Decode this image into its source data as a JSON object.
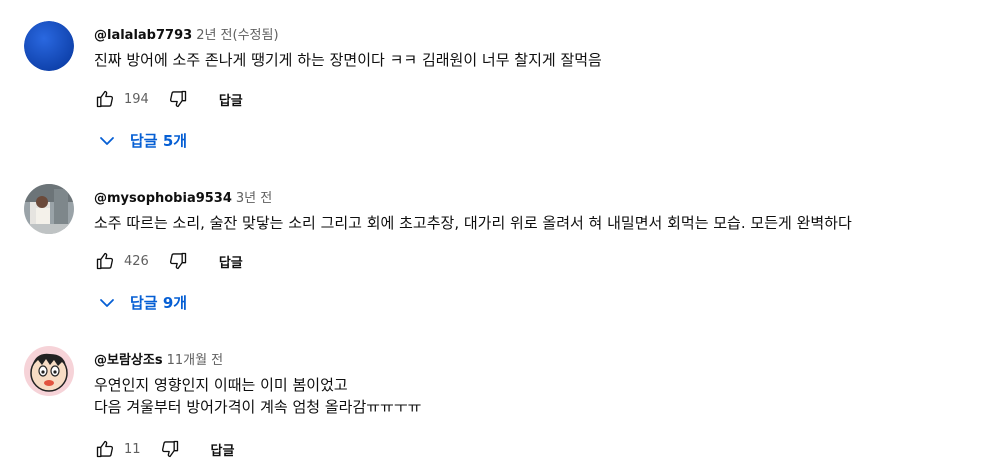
{
  "comments": [
    {
      "author": "@lalalab7793",
      "time": "2년 전(수정됨)",
      "lines": [
        "진짜 방어에 소주 존나게 땡기게 하는 장면이다 ㅋㅋ 김래원이 너무 찰지게 잘먹음"
      ],
      "likes": "194",
      "reply_label": "답글",
      "replies_label": "답글 5개",
      "avatar_color": "#1a4fc0"
    },
    {
      "author": "@mysophobia9534",
      "time": "3년 전",
      "lines": [
        "소주 따르는 소리, 술잔 맞닿는 소리 그리고 회에 초고추장, 대가리 위로 올려서 혀 내밀면서 회먹는 모습. 모든게 완벽하다"
      ],
      "likes": "426",
      "reply_label": "답글",
      "replies_label": "답글 9개"
    },
    {
      "author": "@보람상조s",
      "time": "11개월 전",
      "lines": [
        "우연인지 영향인지 이때는 이미 봄이었고",
        "다음 겨울부터 방어가격이 계속 엄청 올라감ㅠㅠㅜㅠ"
      ],
      "likes": "11",
      "reply_label": "답글"
    }
  ],
  "colors": {
    "link": "#065fd4",
    "secondary_text": "#606060",
    "text": "#0f0f0f"
  }
}
